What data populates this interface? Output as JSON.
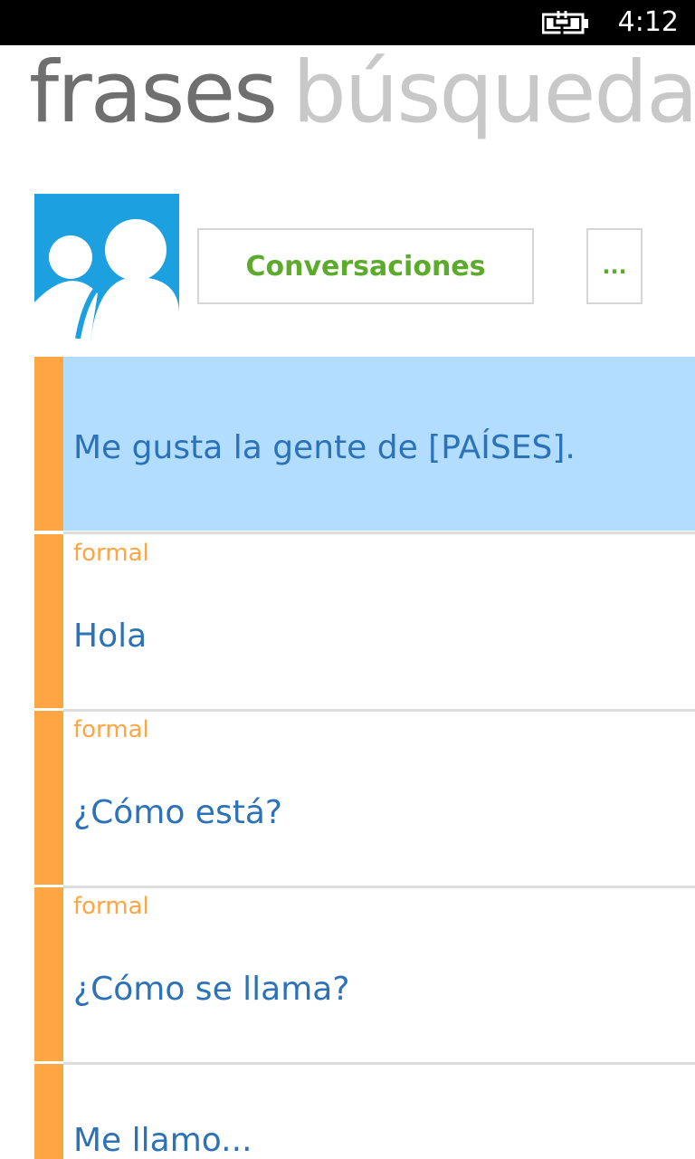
{
  "status_bar": {
    "time": "4:12",
    "battery_icon": "battery-charging-icon"
  },
  "pivot": {
    "active": "frases",
    "next": "búsqueda"
  },
  "toolbar": {
    "avatar_icon": "people-icon",
    "conversations_label": "Conversaciones",
    "more_label": "..."
  },
  "colors": {
    "accent_orange": "#ffa644",
    "selected_bg": "#b3ddfe",
    "phrase_blue": "#2b72b8",
    "button_green": "#5cab2c",
    "avatar_blue": "#1ca0e0"
  },
  "phrases": [
    {
      "tag": "",
      "text": "Me gusta la gente de [PAÍSES].",
      "selected": true
    },
    {
      "tag": "formal",
      "text": "Hola"
    },
    {
      "tag": "formal",
      "text": "¿Cómo está?"
    },
    {
      "tag": "formal",
      "text": "¿Cómo se llama?"
    },
    {
      "tag": "",
      "text": "Me llamo..."
    }
  ]
}
